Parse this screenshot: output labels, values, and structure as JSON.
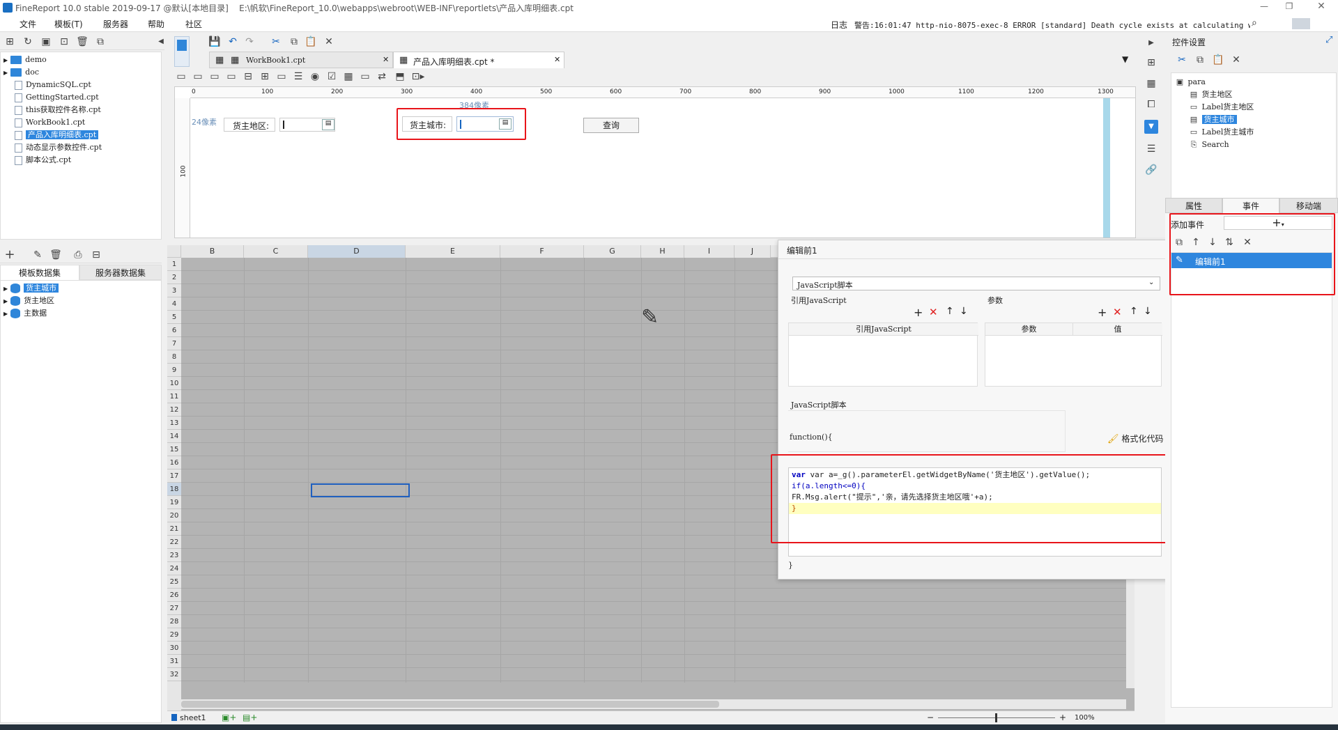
{
  "titlebar": {
    "title": "FineReport 10.0 stable 2019-09-17 @默认[本地目录]    E:\\帆软\\FineReport_10.0\\webapps\\webroot\\WEB-INF\\reportlets\\产品入库明细表.cpt"
  },
  "menu": [
    "文件",
    "模板(T)",
    "服务器",
    "帮助",
    "社区"
  ],
  "log": {
    "label": "日志",
    "warning": "警告:16:01:47 http-nio-8075-exec-8 ERROR [standard] Death cycle exists at calculating widg..."
  },
  "file_tree": [
    {
      "name": "demo",
      "type": "folder"
    },
    {
      "name": "doc",
      "type": "folder"
    },
    {
      "name": "DynamicSQL.cpt",
      "type": "file"
    },
    {
      "name": "GettingStarted.cpt",
      "type": "file"
    },
    {
      "name": "this获取控件名称.cpt",
      "type": "file"
    },
    {
      "name": "WorkBook1.cpt",
      "type": "file"
    },
    {
      "name": "产品入库明细表.cpt",
      "type": "file",
      "selected": true
    },
    {
      "name": "动态显示参数控件.cpt",
      "type": "file"
    },
    {
      "name": "脚本公式.cpt",
      "type": "file"
    }
  ],
  "tabs": [
    {
      "label": "WorkBook1.cpt",
      "active": false
    },
    {
      "label": "产品入库明细表.cpt *",
      "active": true
    }
  ],
  "ruler": [
    "0",
    "100",
    "200",
    "300",
    "400",
    "500",
    "600",
    "700",
    "800",
    "900",
    "1000",
    "1100",
    "1200",
    "1300"
  ],
  "param": {
    "px24": "24像素",
    "px384": "384像素",
    "label_area": "货主地区:",
    "label_city": "货主城市:",
    "query": "查询",
    "vruler": "100"
  },
  "dataset_tabs": {
    "template": "模板数据集",
    "server": "服务器数据集"
  },
  "datasets": [
    "货主城市",
    "货主地区",
    "主数据"
  ],
  "grid": {
    "columns": [
      "B",
      "C",
      "D",
      "E",
      "F",
      "G",
      "H",
      "I",
      "J"
    ],
    "rows": [
      "1",
      "2",
      "3",
      "4",
      "5",
      "6",
      "7",
      "8",
      "9",
      "10",
      "11",
      "12",
      "13",
      "14",
      "15",
      "16",
      "17",
      "18",
      "19",
      "20",
      "21",
      "22",
      "23",
      "24",
      "25",
      "26",
      "27",
      "28",
      "29",
      "30",
      "31",
      "32"
    ]
  },
  "sheet": {
    "name": "sheet1",
    "zoom": "100%"
  },
  "editor": {
    "title": "编辑前1",
    "type": "JavaScript脚本",
    "ref_js": "引用JavaScript",
    "params": "参数",
    "col_ref": "引用JavaScript",
    "col_param": "参数",
    "col_value": "值",
    "js_label": "JavaScript脚本",
    "fn_open": "function(){",
    "format": "格式化代码",
    "code": [
      "var a=_g().parameterEl.getWidgetByName('货主地区').getValue();",
      "if(a.length<=0){",
      "FR.Msg.alert(\"提示\",'亲，请先选择货主地区哦'+a);",
      "}"
    ],
    "fn_close": "}"
  },
  "right_panel": {
    "title": "控件设置",
    "tree": [
      "para",
      "货主地区",
      "Label货主地区",
      "货主城市",
      "Label货主城市",
      "Search"
    ],
    "tabs": [
      "属性",
      "事件",
      "移动端"
    ],
    "add_event": "添加事件",
    "event_item": "编辑前1"
  }
}
